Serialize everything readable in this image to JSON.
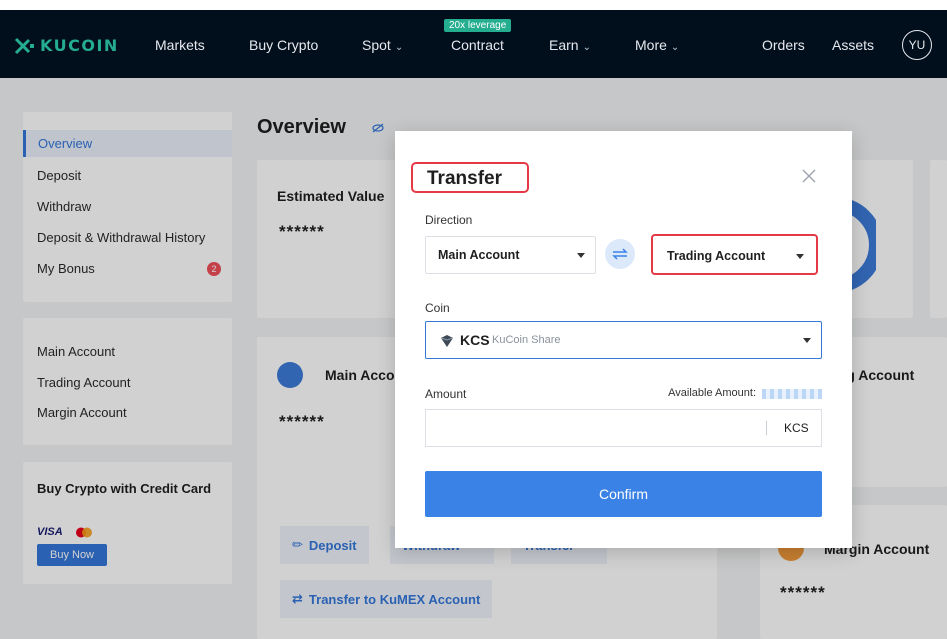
{
  "nav": {
    "logo_text": "KUCOIN",
    "items": [
      {
        "label": "Markets",
        "dropdown": false
      },
      {
        "label": "Buy Crypto",
        "dropdown": false
      },
      {
        "label": "Spot",
        "dropdown": true
      },
      {
        "label": "Contract",
        "dropdown": false
      },
      {
        "label": "Earn",
        "dropdown": true
      },
      {
        "label": "More",
        "dropdown": true
      },
      {
        "label": "Orders",
        "dropdown": false
      },
      {
        "label": "Assets",
        "dropdown": false
      }
    ],
    "contract_badge": "20x leverage",
    "avatar_initials": "YU",
    "colors": {
      "bar": "#010e1c",
      "brand": "#24ae8f"
    }
  },
  "sidebar": {
    "primary": [
      {
        "label": "Overview",
        "active": true
      },
      {
        "label": "Deposit"
      },
      {
        "label": "Withdraw"
      },
      {
        "label": "Deposit & Withdrawal History"
      },
      {
        "label": "My Bonus",
        "badge": "2"
      }
    ],
    "accounts": [
      {
        "label": "Main Account"
      },
      {
        "label": "Trading Account"
      },
      {
        "label": "Margin Account"
      }
    ],
    "promo": {
      "title": "Buy Crypto with Credit Card",
      "visa": "VISA",
      "button": "Buy Now"
    }
  },
  "main": {
    "title": "Overview",
    "estimated_label": "Estimated Value",
    "estimated_value": "******",
    "main_account": {
      "label": "Main Acco",
      "value": "******"
    },
    "trading_account": {
      "label": "ling Account",
      "value": ":"
    },
    "margin_account": {
      "label": "Margin Account",
      "value": "******"
    },
    "actions": {
      "deposit": "Deposit",
      "withdraw": "Withdraw",
      "transfer": "Transfer",
      "kumex": "Transfer to KuMEX Account"
    }
  },
  "modal": {
    "title": "Transfer",
    "direction_label": "Direction",
    "from_account": "Main Account",
    "to_account": "Trading Account",
    "coin_label": "Coin",
    "coin_symbol": "KCS",
    "coin_name": "KuCoin Share",
    "amount_label": "Amount",
    "available_label": "Available Amount:",
    "amount_value": "",
    "amount_unit": "KCS",
    "confirm_label": "Confirm",
    "colors": {
      "primary": "#3a82e6",
      "highlight": "#e53946"
    }
  }
}
